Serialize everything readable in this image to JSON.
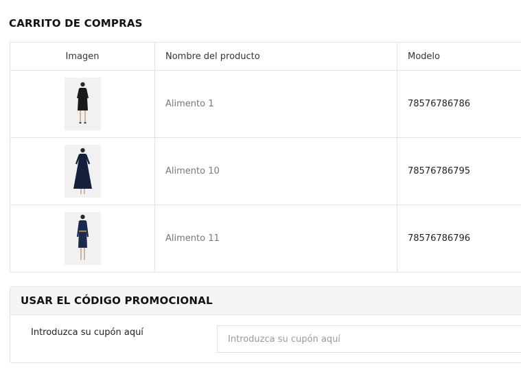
{
  "cart": {
    "title": "CARRITO DE COMPRAS",
    "columns": {
      "image": "Imagen",
      "name": "Nombre del producto",
      "model": "Modelo"
    },
    "items": [
      {
        "name": "Alimento 1",
        "model": "78576786786",
        "thumb_icon": "black-dress-image",
        "dress_color": "#1a1a1a"
      },
      {
        "name": "Alimento 10",
        "model": "78576786795",
        "thumb_icon": "navy-maxi-dress-image",
        "dress_color": "#15203a"
      },
      {
        "name": "Alimento 11",
        "model": "78576786796",
        "thumb_icon": "navy-belted-dress-image",
        "dress_color": "#1b2a4d"
      }
    ]
  },
  "promo": {
    "title": "USAR EL CÓDIGO PROMOCIONAL",
    "label": "Introduzca su cupón aquí",
    "placeholder": "Introduzca su cupón aquí",
    "value": ""
  }
}
